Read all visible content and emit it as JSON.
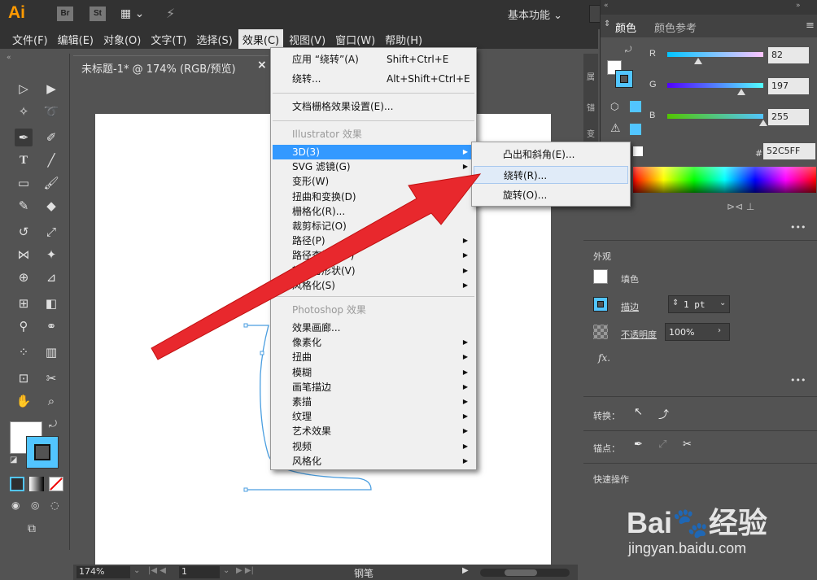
{
  "app": {
    "logo": "Ai",
    "bridge": "Br",
    "stock": "St",
    "workspace": "基本功能"
  },
  "menubar": [
    {
      "label": "文件(F)",
      "name": "menu-file"
    },
    {
      "label": "编辑(E)",
      "name": "menu-edit"
    },
    {
      "label": "对象(O)",
      "name": "menu-object"
    },
    {
      "label": "文字(T)",
      "name": "menu-type"
    },
    {
      "label": "选择(S)",
      "name": "menu-select"
    },
    {
      "label": "效果(C)",
      "name": "menu-effect"
    },
    {
      "label": "视图(V)",
      "name": "menu-view"
    },
    {
      "label": "窗口(W)",
      "name": "menu-window"
    },
    {
      "label": "帮助(H)",
      "name": "menu-help"
    }
  ],
  "document": {
    "tab_label": "未标题-1* @ 174% (RGB/预览)",
    "close": "×"
  },
  "effects_menu": {
    "apply_last": "应用 “绕转”(A)",
    "apply_last_shortcut": "Shift+Ctrl+E",
    "last": "绕转...",
    "last_shortcut": "Alt+Shift+Ctrl+E",
    "raster_settings": "文档栅格效果设置(E)...",
    "illustrator_section": "Illustrator 效果",
    "illustrator_items": [
      "3D(3)",
      "SVG 滤镜(G)",
      "变形(W)",
      "扭曲和变换(D)",
      "栅格化(R)...",
      "裁剪标记(O)",
      "路径(P)",
      "路径查找器(F)",
      "转换为形状(V)",
      "风格化(S)"
    ],
    "photoshop_section": "Photoshop 效果",
    "photoshop_items": [
      "效果画廊...",
      "像素化",
      "扭曲",
      "模糊",
      "画笔描边",
      "素描",
      "纹理",
      "艺术效果",
      "视频",
      "风格化"
    ]
  },
  "submenu_3d": [
    "凸出和斜角(E)...",
    "绕转(R)...",
    "旋转(O)..."
  ],
  "color_panel": {
    "tab_color": "颜色",
    "tab_color_guide": "颜色参考",
    "r_label": "R",
    "r_value": "82",
    "g_label": "G",
    "g_value": "197",
    "b_label": "B",
    "b_value": "255",
    "hex_label": "#",
    "hex_value": "52C5FF",
    "r_fraction": 0.32,
    "g_fraction": 0.77,
    "b_fraction": 1.0
  },
  "appearance_panel": {
    "title": "外观",
    "fill": "填色",
    "stroke": "描边",
    "stroke_weight": "1 pt",
    "opacity_label": "不透明度",
    "opacity_value": "100%",
    "fx": "fx.",
    "convert_label": "转换：",
    "anchor_label": "锚点：",
    "quick_actions": "快速操作",
    "more": "•••"
  },
  "status": {
    "zoom": "174%",
    "page": "1",
    "tool": "钢笔"
  },
  "watermark": {
    "brand": "Bai🐾经验",
    "url": "jingyan.baidu.com"
  },
  "colors": {
    "accent": "#3399ff",
    "stroke_color": "#52C5FF"
  }
}
